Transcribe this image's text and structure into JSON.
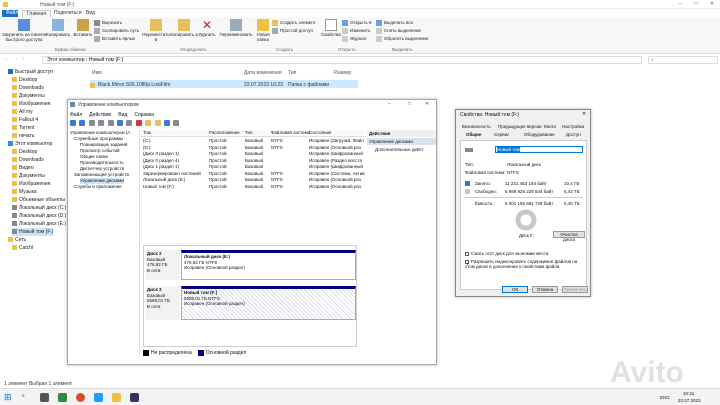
{
  "explorer": {
    "title": "Новый том (F:)",
    "tabs": [
      "Файл",
      "Главная",
      "Поделиться",
      "Вид"
    ],
    "ribbon": {
      "pin": "Закрепить на панели быстрого доступа",
      "copy": "Копировать",
      "paste": "Вставить",
      "cut": "Вырезать",
      "copy_path": "Скопировать путь",
      "paste_shortcut": "Вставить ярлык",
      "clipboard_group": "Буфер обмена",
      "move_to": "Переместить в",
      "copy_to": "Копировать в",
      "delete": "Удалить",
      "rename": "Переименовать",
      "organize_group": "Упорядочить",
      "new_folder": "Новая папка",
      "new_item": "Создать элемент",
      "easy_access": "Простой доступ",
      "create_group": "Создать",
      "properties": "Свойства",
      "open": "Открыть",
      "edit": "Изменить",
      "history": "Журнал",
      "open_group": "Открыть",
      "select_all": "Выделить все",
      "select_none": "Снять выделение",
      "invert": "Обратить выделение",
      "select_group": "Выделить"
    },
    "address": [
      "Этот компьютер",
      "Новый том (F:)"
    ],
    "nav": [
      "Быстрый доступ",
      "Desktop",
      "Downloads",
      "Документы",
      "Изображения",
      "All my",
      "Fallout 4",
      "Torrent",
      "печать",
      "Этот компьютер",
      "Desktop",
      "Downloads",
      "Видео",
      "Документы",
      "Изображения",
      "Музыка",
      "Объемные объекты",
      "Локальный диск (C:)",
      "Локальный диск (D:)",
      "Локальный диск (E:)",
      "Новый том (F:)",
      "Сеть",
      "Catchl"
    ],
    "columns": [
      "Имя",
      "Дата изменения",
      "Тип",
      "Размер"
    ],
    "files": [
      {
        "name": "Black.Mirror.S06.1080p.LostFilm",
        "date": "22.07.2023 10:23",
        "type": "Папка с файлами",
        "size": ""
      }
    ],
    "status": "1 элемент   Выбран 1 элемент"
  },
  "disk_mgmt": {
    "title": "Управление компьютером",
    "menu": [
      "Файл",
      "Действие",
      "Вид",
      "Справка"
    ],
    "tree": [
      "Управление компьютером (л",
      "Служебные программы",
      "Планировщик заданий",
      "Просмотр событий",
      "Общие папки",
      "Производительность",
      "Диспетчер устройств",
      "Запоминающие устройств",
      "Управление дисками",
      "Службы и приложения"
    ],
    "columns": [
      "Том",
      "Расположение",
      "Тип",
      "Файловая система",
      "Состояние"
    ],
    "volumes": [
      {
        "name": "(C:)",
        "layout": "Простой",
        "type": "Базовый",
        "fs": "NTFS",
        "status": "Исправен (Загрузка, Файл"
      },
      {
        "name": "(D:)",
        "layout": "Простой",
        "type": "Базовый",
        "fs": "NTFS",
        "status": "Исправен (Основной раз"
      },
      {
        "name": "(Диск 0 раздел 1)",
        "layout": "Простой",
        "type": "Базовый",
        "fs": "",
        "status": "Исправен (Шифрованный"
      },
      {
        "name": "(Диск 0 раздел 4)",
        "layout": "Простой",
        "type": "Базовый",
        "fs": "",
        "status": "Исправен (Раздел восста"
      },
      {
        "name": "(Диск 1 раздел 1)",
        "layout": "Простой",
        "type": "Базовый",
        "fs": "",
        "status": "Исправен (Шифрованный"
      },
      {
        "name": "Зарезервировано системой",
        "layout": "Простой",
        "type": "Базовый",
        "fs": "NTFS",
        "status": "Исправен (Система, Актив"
      },
      {
        "name": "Локальный диск (E:)",
        "layout": "Простой",
        "type": "Базовый",
        "fs": "NTFS",
        "status": "Исправен (Основной раз"
      },
      {
        "name": "Новый том (F:)",
        "layout": "Простой",
        "type": "Базовый",
        "fs": "NTFS",
        "status": "Исправен (Основной раз"
      }
    ],
    "disks": [
      {
        "label": "Диск 2",
        "type": "Базовый",
        "size": "476,92 ГБ",
        "state": "В сети",
        "part_name": "Локальный диск (E:)",
        "part_size": "476,92 ГБ NTFS",
        "part_state": "Исправен (Основной раздел)"
      },
      {
        "label": "Диск 3",
        "type": "Базовый",
        "size": "5589,01 ГБ",
        "state": "В сети",
        "part_name": "Новый том (F:)",
        "part_size": "5589,01 ГБ NTFS",
        "part_state": "Исправен (Основной раздел)"
      }
    ],
    "legend": [
      "Не распределена",
      "Основной раздел"
    ],
    "actions_header": "Действия",
    "actions": [
      "Управление дисками",
      "Дополнительные дейст"
    ]
  },
  "props": {
    "title": "Свойства: Новый том (F:)",
    "tabs_row1": [
      "Безопасность",
      "Предыдущие версии",
      "Квота",
      "Настройка"
    ],
    "tabs_row2": [
      "Общие",
      "Сервис",
      "Оборудование",
      "Доступ"
    ],
    "name": "Новый том",
    "type_label": "Тип:",
    "type_value": "Локальный диск",
    "fs_label": "Файловая система:",
    "fs_value": "NTFS",
    "used_label": "Занято:",
    "used_bytes": "11 231 453 184 байт",
    "used_gb": "10,4 ГБ",
    "free_label": "Свободно:",
    "free_bytes": "5 989 925 228 544 байт",
    "free_gb": "5,44 ТБ",
    "cap_label": "Ёмкость:",
    "cap_bytes": "6 001 156 681 728 байт",
    "cap_gb": "5,45 ТБ",
    "used_fraction": 0.002,
    "disk_label": "Диск F:",
    "cleanup": "Очистка диска",
    "compress": "Сжать этот диск для экономии места",
    "index": "Разрешить индексировать содержимое файлов на этом диске в дополнение к свойствам файла",
    "ok": "ОК",
    "cancel": "Отмена",
    "apply": "Применить"
  },
  "taskbar": {
    "lang": "ENG",
    "time": "10:31",
    "date": "22.07.2023"
  },
  "colors": {
    "used": "#2a7bd4",
    "free": "#c8c8c8",
    "primary_partition": "#000080",
    "selection": "#cce4f7"
  }
}
